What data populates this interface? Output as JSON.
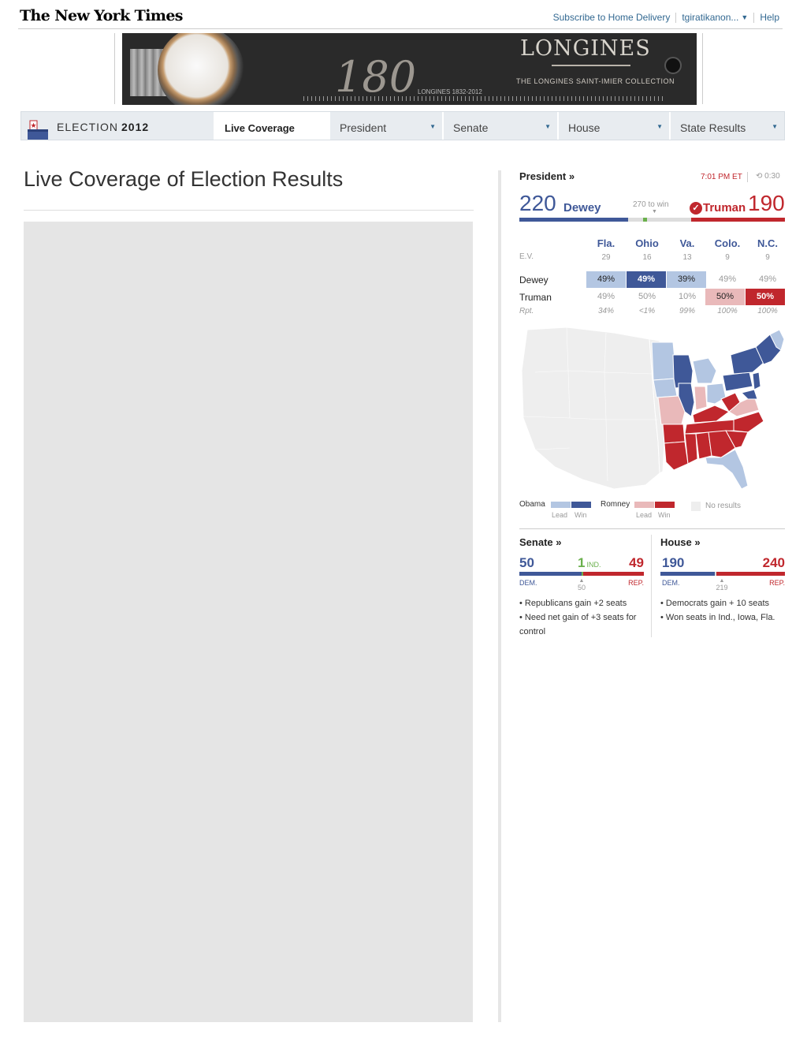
{
  "header": {
    "logo": "The New York Times",
    "subscribe": "Subscribe to Home Delivery",
    "user": "tgiratikanon...",
    "help": "Help"
  },
  "ad": {
    "number": "180",
    "brand": "LONGINES",
    "collection": "THE LONGINES SAINT-IMIER COLLECTION",
    "years": "LONGINES 1832-2012"
  },
  "nav": {
    "brand_prefix": "ELECTION",
    "brand_year": "2012",
    "tabs": [
      {
        "label": "Live Coverage",
        "active": true
      },
      {
        "label": "President"
      },
      {
        "label": "Senate"
      },
      {
        "label": "House"
      },
      {
        "label": "State Results"
      }
    ]
  },
  "main": {
    "title": "Live Coverage of Election Results"
  },
  "president": {
    "title": "President »",
    "time": "7:01 PM ET",
    "countdown": "0:30",
    "dem_ev": "220",
    "dem_name": "Dewey",
    "rep_ev": "190",
    "rep_name": "Truman",
    "to_win": "270 to win",
    "dem_ev_value": 220,
    "rep_ev_value": 190,
    "total_ev": 538,
    "ev_label": "E.V.",
    "rpt_label": "Rpt.",
    "states": [
      {
        "name": "Fla.",
        "ev": "29",
        "dem": "49%",
        "rep": "49%",
        "rpt": "34%",
        "dem_class": "c-dl",
        "rep_class": ""
      },
      {
        "name": "Ohio",
        "ev": "16",
        "dem": "49%",
        "rep": "50%",
        "rpt": "<1%",
        "dem_class": "c-dw",
        "rep_class": ""
      },
      {
        "name": "Va.",
        "ev": "13",
        "dem": "39%",
        "rep": "10%",
        "rpt": "99%",
        "dem_class": "c-dl",
        "rep_class": ""
      },
      {
        "name": "Colo.",
        "ev": "9",
        "dem": "49%",
        "rep": "50%",
        "rpt": "100%",
        "dem_class": "",
        "rep_class": "c-rl"
      },
      {
        "name": "N.C.",
        "ev": "9",
        "dem": "49%",
        "rep": "50%",
        "rpt": "100%",
        "dem_class": "",
        "rep_class": "c-rw"
      }
    ],
    "dem_row_label": "Dewey",
    "rep_row_label": "Truman"
  },
  "legend": {
    "obama": "Obama",
    "romney": "Romney",
    "no_results": "No results",
    "lead": "Lead",
    "win": "Win",
    "colors": {
      "dem_lead": "#b3c6e2",
      "dem_win": "#3f5898",
      "rep_lead": "#e9b9ba",
      "rep_win": "#c0272d",
      "none": "#eeeeee"
    }
  },
  "senate": {
    "title": "Senate »",
    "dem": "50",
    "ind": "1",
    "ind_label": "IND.",
    "rep": "49",
    "dem_label": "DEM.",
    "rep_label": "REP.",
    "majority": "50",
    "dem_value": 50,
    "ind_value": 1,
    "rep_value": 49,
    "total": 100,
    "notes": [
      "• Republicans gain +2 seats",
      "• Need net gain of +3 seats for control"
    ]
  },
  "house": {
    "title": "House »",
    "dem": "190",
    "rep": "240",
    "dem_label": "DEM.",
    "rep_label": "REP.",
    "majority": "219",
    "dem_value": 190,
    "rep_value": 240,
    "total": 435,
    "notes": [
      "• Democrats gain + 10 seats",
      "• Won seats in Ind., Iowa, Fla."
    ]
  }
}
